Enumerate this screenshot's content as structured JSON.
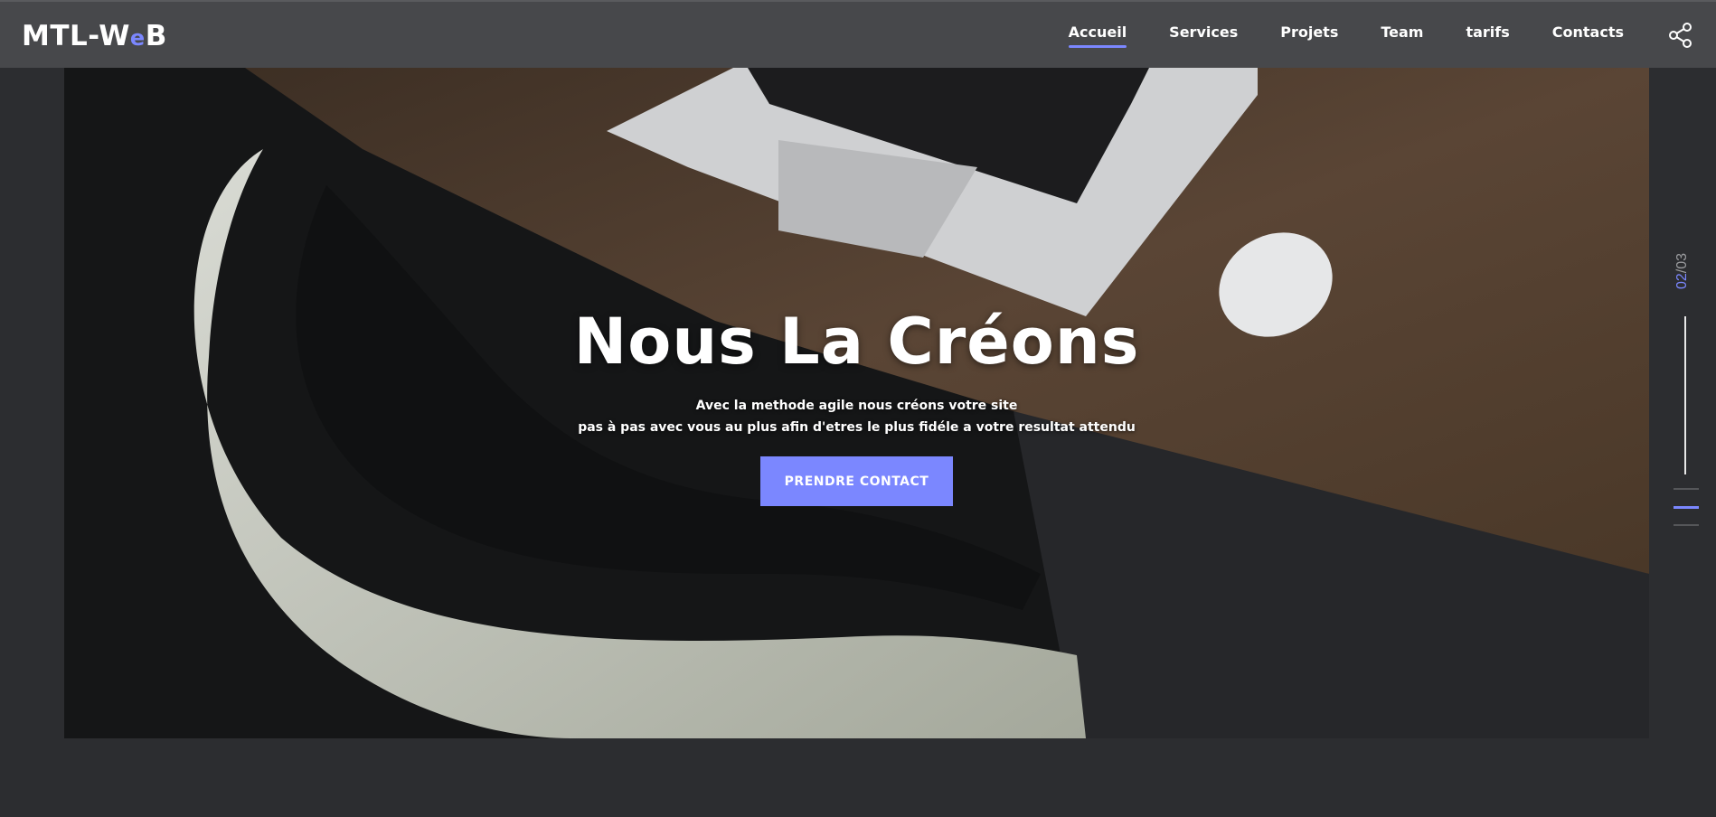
{
  "brand": {
    "logo_left": "MTL-W",
    "logo_accent": "e",
    "logo_right": "B"
  },
  "nav": {
    "items": [
      {
        "label": "Accueil",
        "active": true
      },
      {
        "label": "Services",
        "active": false
      },
      {
        "label": "Projets",
        "active": false
      },
      {
        "label": "Team",
        "active": false
      },
      {
        "label": "tarifs",
        "active": false
      },
      {
        "label": "Contacts",
        "active": false
      }
    ],
    "share_icon": "share-icon"
  },
  "hero": {
    "title": "Nous La Créons",
    "subtitle_line1": "Avec la methode agile nous créons votre site",
    "subtitle_line2": "pas à pas avec vous au plus afin d'etres le plus fidéle a votre resultat attendu",
    "cta_label": "PRENDRE CONTACT"
  },
  "slider": {
    "current": "02",
    "separator": "/",
    "total": "03"
  },
  "colors": {
    "accent": "#7b87ff",
    "topbar": "#47484b",
    "background": "#2c2d30"
  }
}
